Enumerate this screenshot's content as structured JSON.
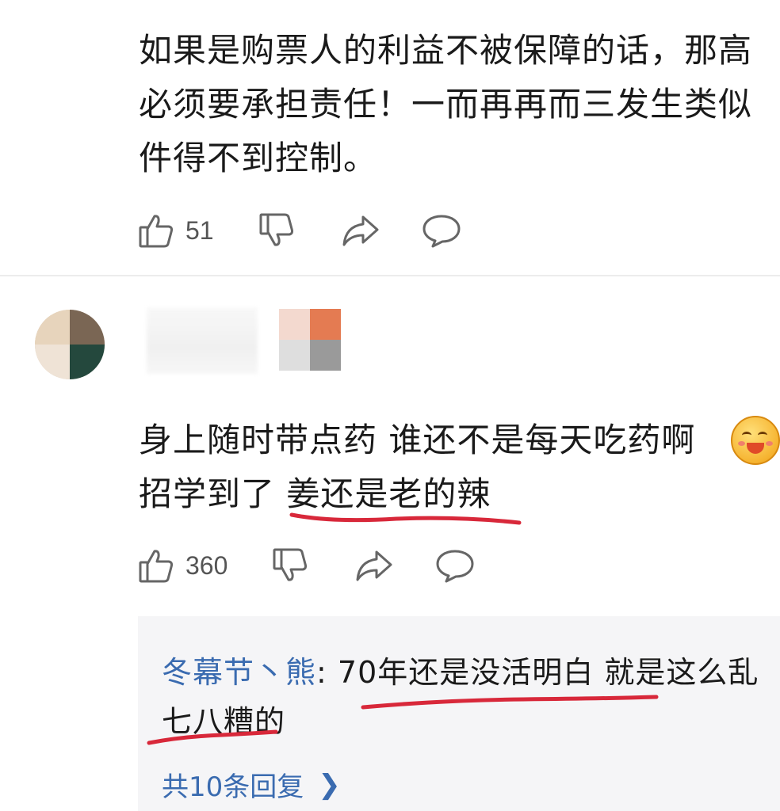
{
  "comment1": {
    "text_lines": [
      "如果是购票人的利益不被保障的话，那高",
      "必须要承担责任！一而再再而三发生类似",
      "件得不到控制。"
    ],
    "like_count": "51"
  },
  "comment2": {
    "text_line1": "身上随时带点药 谁还不是每天吃药啊",
    "text_line2_plain": "招学到了 ",
    "text_line2_underlined": "姜还是老的辣",
    "emoji": "laughing-face-emoji",
    "like_count": "360",
    "reply": {
      "author": "冬幕节丶熊",
      "separator": ":",
      "text": " 70年还是没活明白 就是这么乱七八糟的",
      "more": "共10条回复"
    }
  },
  "colors": {
    "link": "#3a6bb0",
    "annotation": "#d8283a",
    "reply_bg": "#f5f5f7"
  }
}
